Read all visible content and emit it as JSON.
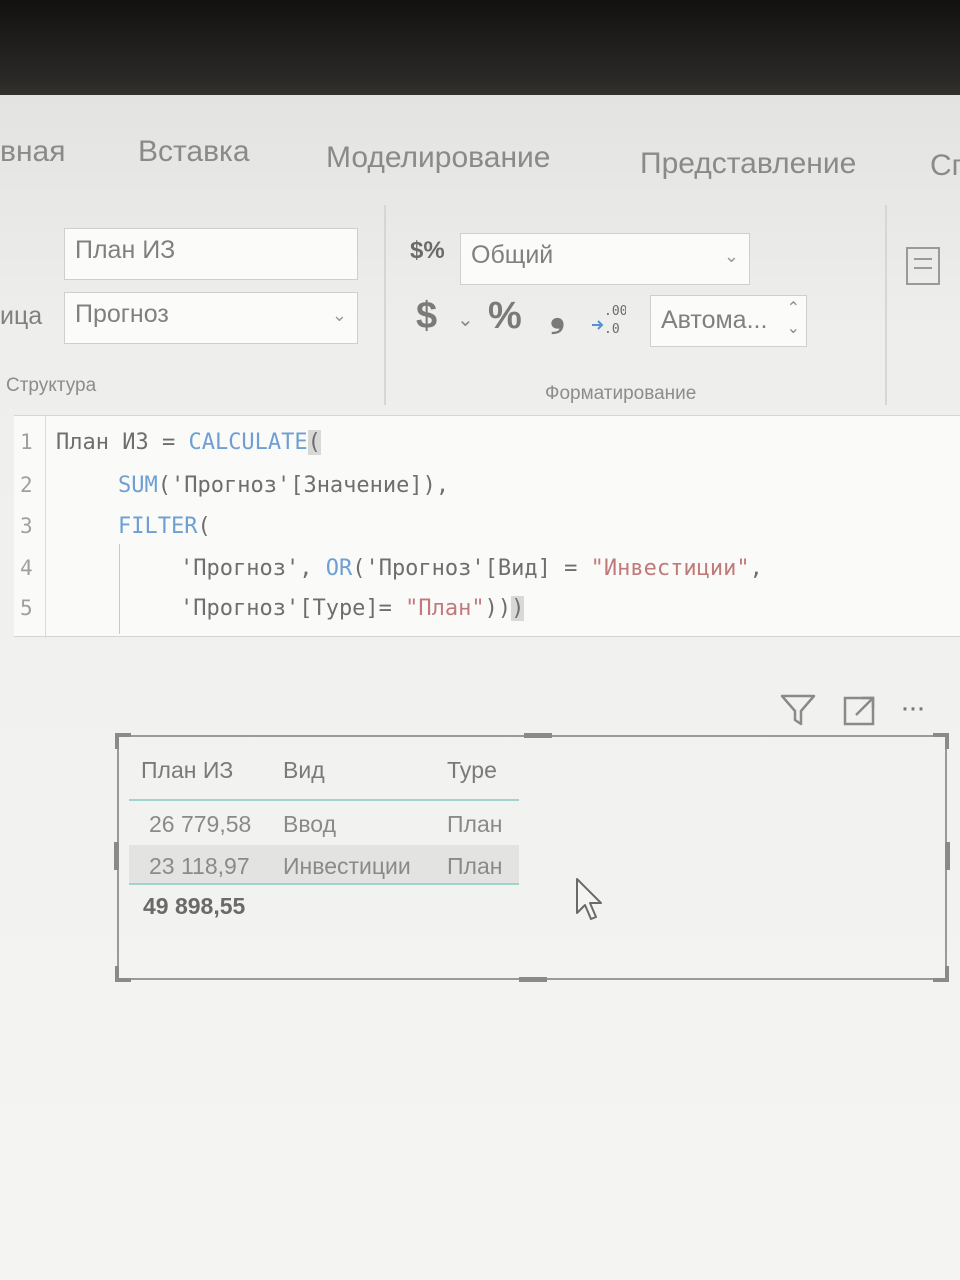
{
  "ribbon_tabs": [
    "вная",
    "Вставка",
    "Моделирование",
    "Представление",
    "Сп"
  ],
  "structure": {
    "name_value": "План ИЗ",
    "table_label": "ица",
    "table_value": "Прогноз",
    "group_label": "Структура"
  },
  "formatting": {
    "format_icon": "$%",
    "format_value": "Общий",
    "currency_symbol": "$",
    "currency_caret": "⌄",
    "percent_symbol": "%",
    "comma_symbol": "❟",
    "decimals_icon": "decimal-places-icon",
    "decimals_value": "Автома...",
    "group_label": "Форматирование"
  },
  "formula": {
    "line_numbers": [
      "1",
      "2",
      "3",
      "4",
      "5"
    ],
    "line1": {
      "prefix": "План ИЗ = ",
      "fn": "CALCULATE",
      "suffix": "("
    },
    "line2": {
      "fn": "SUM",
      "suffix": "('Прогноз'[Значение]),"
    },
    "line3": {
      "fn": "FILTER",
      "suffix": "("
    },
    "line4": {
      "prefix": "'Прогноз', ",
      "fn": "OR",
      "mid": "('Прогноз'[Вид] = ",
      "str": "\"Инвестиции\"",
      "suffix": ","
    },
    "line5": {
      "prefix": "'Прогноз'[Type]= ",
      "str": "\"План\"",
      "suffix": "))",
      "cursor_char": ")"
    }
  },
  "visual_header": {
    "filter_icon": "filter-icon",
    "focus_icon": "focus-mode-icon",
    "more_icon": "more-options-icon",
    "more_glyph": "···"
  },
  "table": {
    "columns": [
      "План ИЗ",
      "Вид",
      "Type"
    ],
    "rows": [
      [
        "26 779,58",
        "Ввод",
        "План"
      ],
      [
        "23 118,97",
        "Инвестиции",
        "План"
      ]
    ],
    "total": "49 898,55"
  },
  "colors": {
    "function": "#6f9fd2",
    "string": "#c17a7a",
    "table_accent": "#9fd3cc"
  }
}
